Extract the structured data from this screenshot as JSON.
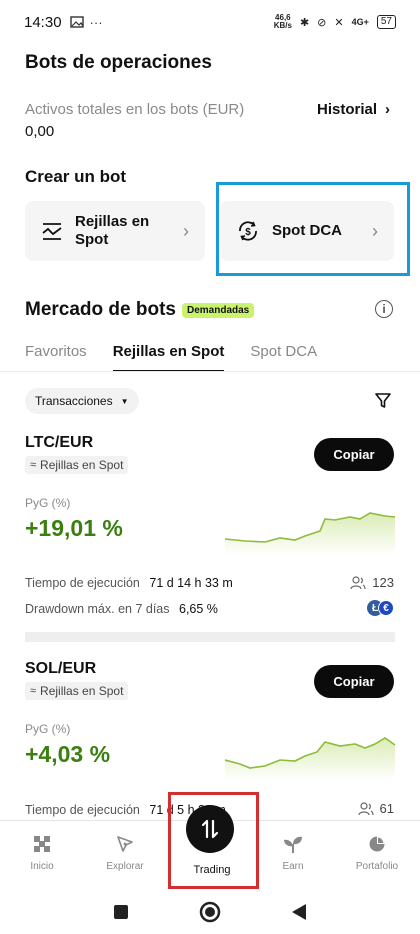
{
  "status_bar": {
    "time": "14:30",
    "net_speed_value": "46,6",
    "net_speed_unit": "KB/s",
    "signal_label": "4G+",
    "battery": "57"
  },
  "header": {
    "title": "Bots de operaciones"
  },
  "assets": {
    "label": "Activos totales en los bots (EUR)",
    "value": "0,00",
    "history_label": "Historial"
  },
  "create_bot": {
    "title": "Crear un bot",
    "cards": [
      {
        "label": "Rejillas en Spot",
        "icon": "grid-chart-icon"
      },
      {
        "label": "Spot DCA",
        "icon": "dollar-cycle-icon"
      }
    ]
  },
  "market": {
    "title": "Mercado de bots",
    "badge": "Demandadas",
    "tabs": [
      "Favoritos",
      "Rejillas en Spot",
      "Spot DCA"
    ],
    "active_tab": "Rejillas en Spot",
    "filter_label": "Transacciones"
  },
  "bots": [
    {
      "pair": "LTC/EUR",
      "type": "Rejillas en Spot",
      "copy_label": "Copiar",
      "pnl_label": "PyG (%)",
      "pnl_value": "+19,01 %",
      "runtime_label": "Tiempo de ejecución",
      "runtime_value": "71 d 14 h 33 m",
      "drawdown_label": "Drawdown máx. en 7 días",
      "drawdown_value": "6,65 %",
      "users": "123"
    },
    {
      "pair": "SOL/EUR",
      "type": "Rejillas en Spot",
      "copy_label": "Copiar",
      "pnl_label": "PyG (%)",
      "pnl_value": "+4,03 %",
      "runtime_label": "Tiempo de ejecución",
      "runtime_value": "71 d 5 h 30 m",
      "users": "61"
    }
  ],
  "bottom_nav": {
    "items": [
      "Inicio",
      "Explorar",
      "Trading",
      "Earn",
      "Portafolio"
    ],
    "active": "Trading"
  },
  "colors": {
    "accent_green": "#3a7f0f",
    "badge_green": "#c9f36c",
    "highlight_blue": "#1a9ad6",
    "highlight_red": "#d32f2f"
  }
}
